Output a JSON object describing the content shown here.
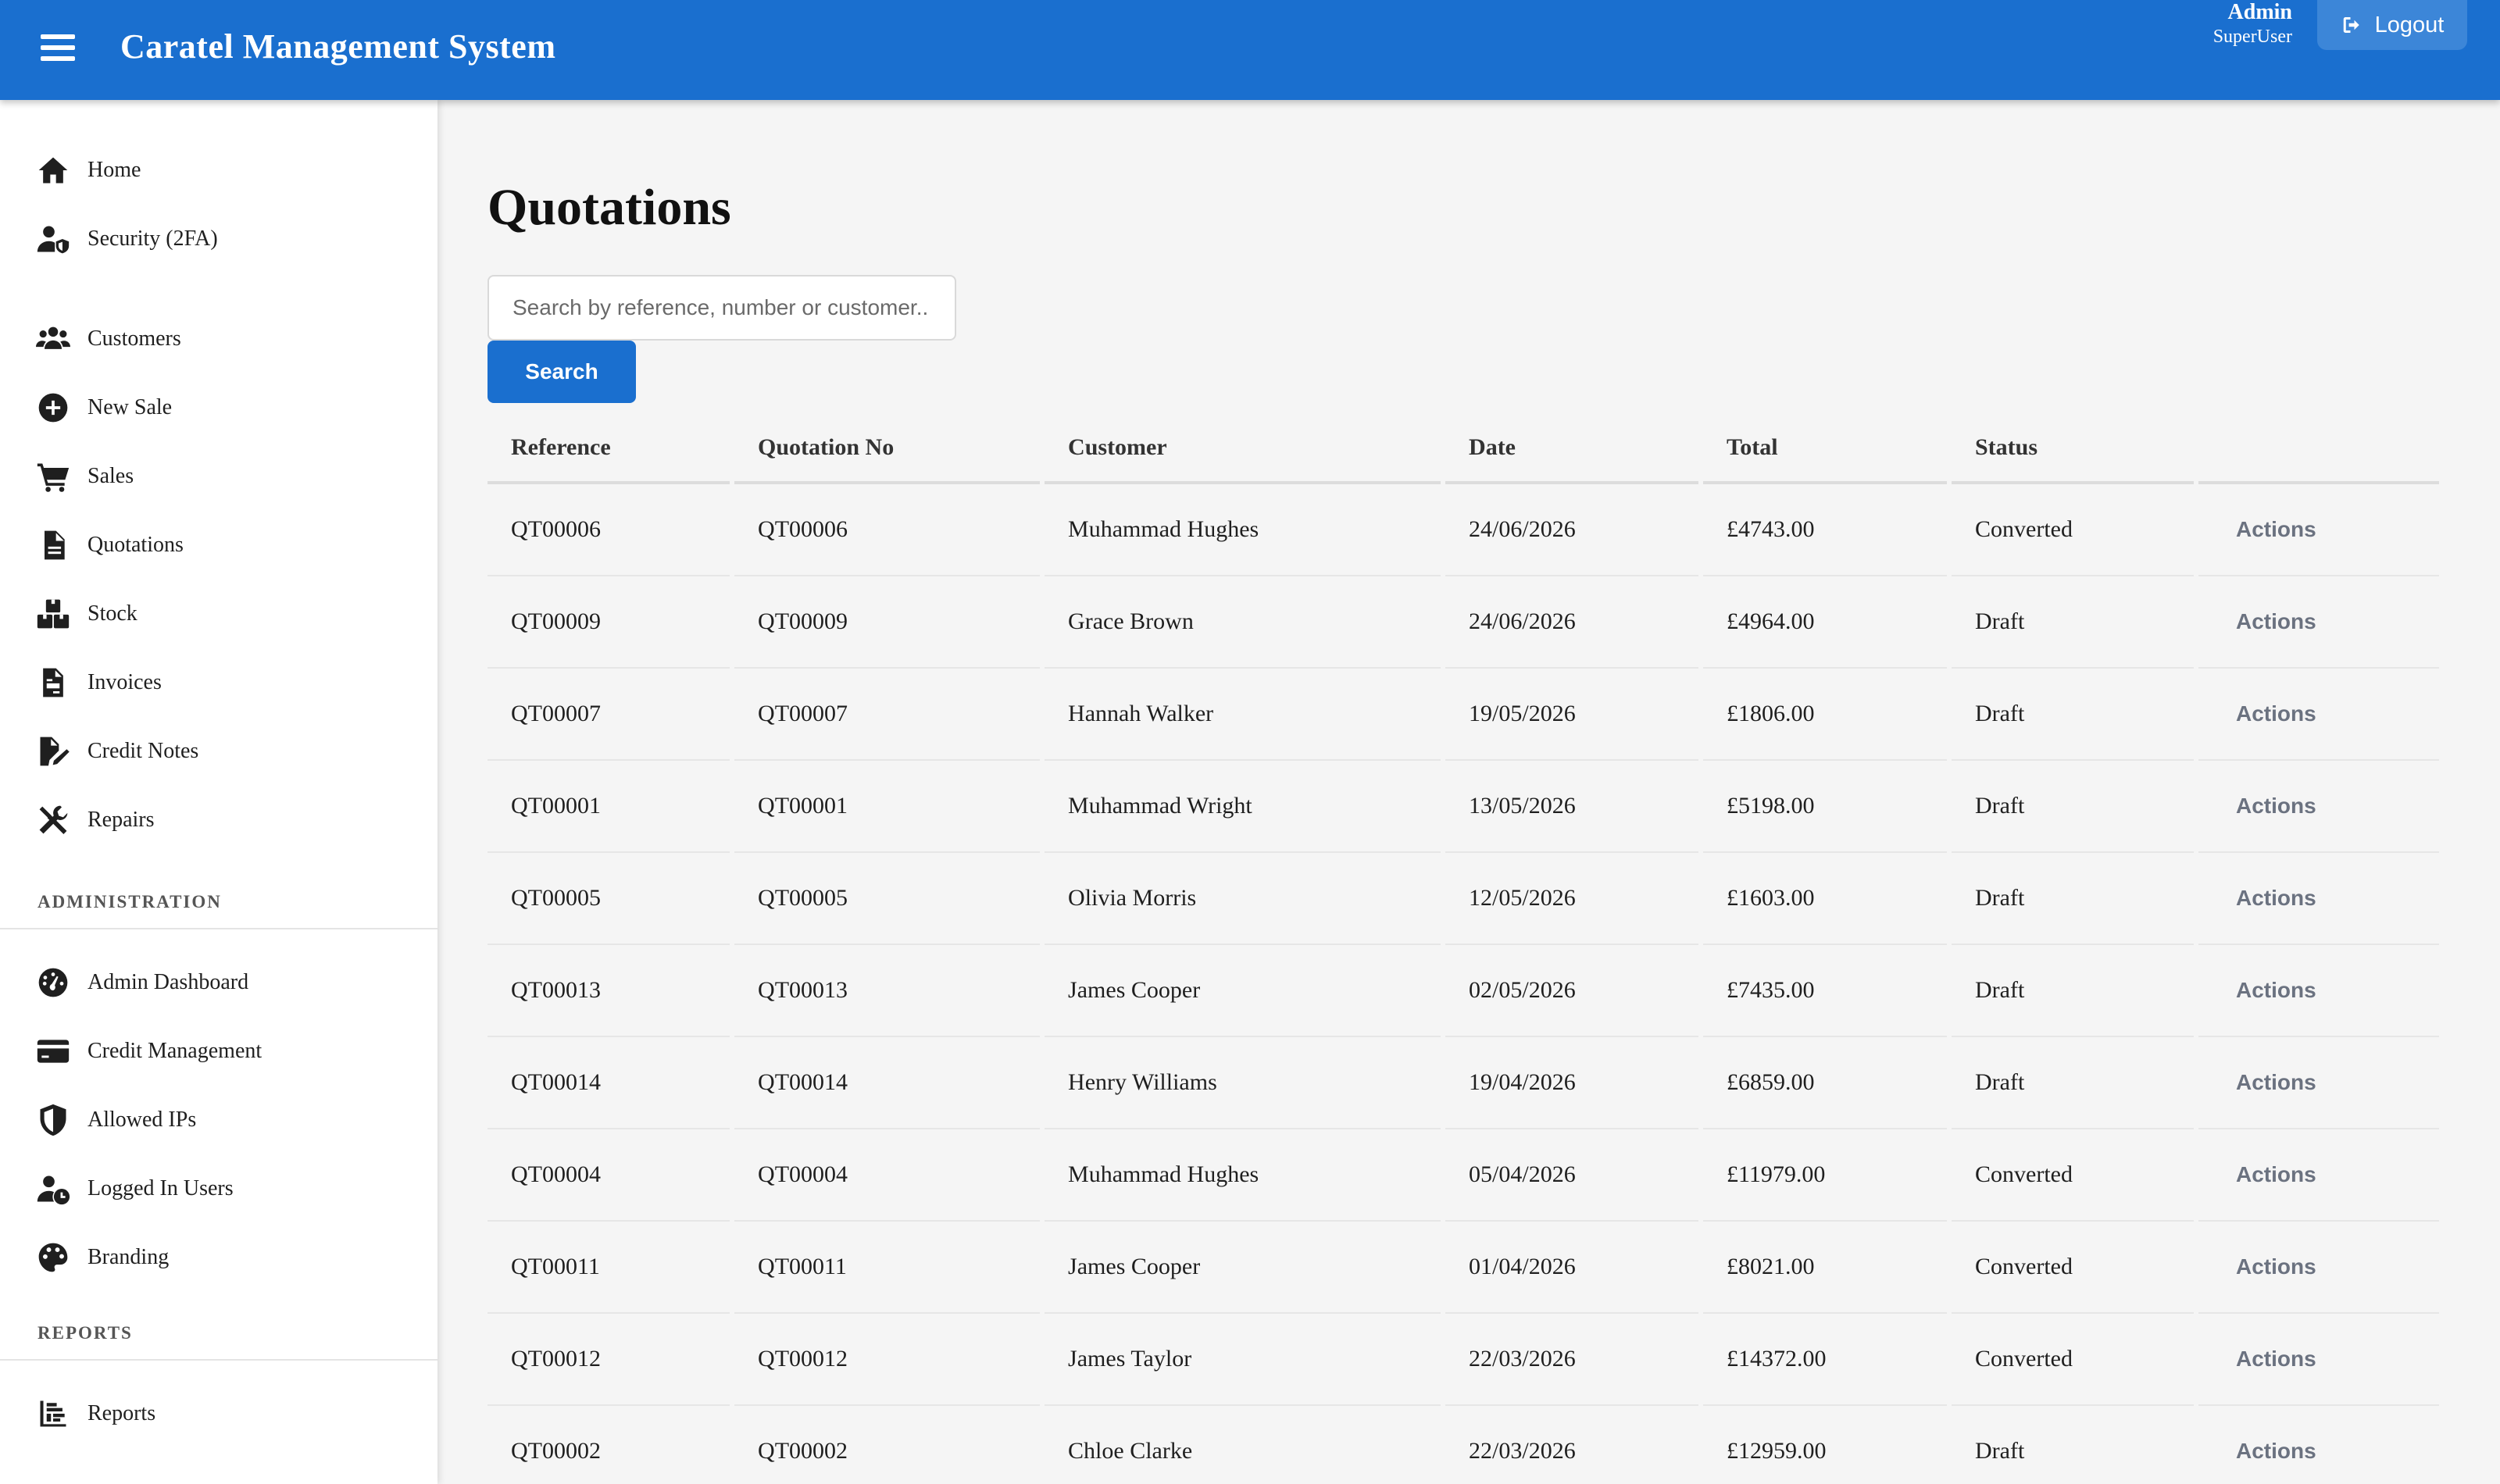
{
  "header": {
    "app_title": "Caratel Management System",
    "user_name": "Admin",
    "user_role": "SuperUser",
    "logout_label": "Logout",
    "brand_color": "#1a6fcf"
  },
  "sidebar": {
    "main_items": [
      {
        "label": "Home",
        "icon": "home-icon"
      },
      {
        "label": "Security (2FA)",
        "icon": "user-shield-icon"
      }
    ],
    "operations_items": [
      {
        "label": "Customers",
        "icon": "users-icon"
      },
      {
        "label": "New Sale",
        "icon": "plus-circle-icon"
      },
      {
        "label": "Sales",
        "icon": "cart-icon"
      },
      {
        "label": "Quotations",
        "icon": "file-icon"
      },
      {
        "label": "Stock",
        "icon": "boxes-icon"
      },
      {
        "label": "Invoices",
        "icon": "invoice-icon"
      },
      {
        "label": "Credit Notes",
        "icon": "file-edit-icon"
      },
      {
        "label": "Repairs",
        "icon": "tools-icon"
      }
    ],
    "admin_section_title": "ADMINISTRATION",
    "admin_items": [
      {
        "label": "Admin Dashboard",
        "icon": "dashboard-gauge-icon"
      },
      {
        "label": "Credit Management",
        "icon": "credit-card-icon"
      },
      {
        "label": "Allowed IPs",
        "icon": "shield-icon"
      },
      {
        "label": "Logged In Users",
        "icon": "user-clock-icon"
      },
      {
        "label": "Branding",
        "icon": "palette-icon"
      }
    ],
    "reports_section_title": "REPORTS",
    "reports_items": [
      {
        "label": "Reports",
        "icon": "bar-chart-icon"
      }
    ]
  },
  "main": {
    "page_title": "Quotations",
    "search": {
      "placeholder": "Search by reference, number or customer..",
      "button_label": "Search"
    },
    "table": {
      "columns": [
        "Reference",
        "Quotation No",
        "Customer",
        "Date",
        "Total",
        "Status",
        ""
      ],
      "action_label": "Actions",
      "rows": [
        {
          "reference": "QT00006",
          "quotation_no": "QT00006",
          "customer": "Muhammad Hughes",
          "date": "24/06/2026",
          "total": "£4743.00",
          "status": "Converted"
        },
        {
          "reference": "QT00009",
          "quotation_no": "QT00009",
          "customer": "Grace Brown",
          "date": "24/06/2026",
          "total": "£4964.00",
          "status": "Draft"
        },
        {
          "reference": "QT00007",
          "quotation_no": "QT00007",
          "customer": "Hannah Walker",
          "date": "19/05/2026",
          "total": "£1806.00",
          "status": "Draft"
        },
        {
          "reference": "QT00001",
          "quotation_no": "QT00001",
          "customer": "Muhammad Wright",
          "date": "13/05/2026",
          "total": "£5198.00",
          "status": "Draft"
        },
        {
          "reference": "QT00005",
          "quotation_no": "QT00005",
          "customer": "Olivia Morris",
          "date": "12/05/2026",
          "total": "£1603.00",
          "status": "Draft"
        },
        {
          "reference": "QT00013",
          "quotation_no": "QT00013",
          "customer": "James Cooper",
          "date": "02/05/2026",
          "total": "£7435.00",
          "status": "Draft"
        },
        {
          "reference": "QT00014",
          "quotation_no": "QT00014",
          "customer": "Henry Williams",
          "date": "19/04/2026",
          "total": "£6859.00",
          "status": "Draft"
        },
        {
          "reference": "QT00004",
          "quotation_no": "QT00004",
          "customer": "Muhammad Hughes",
          "date": "05/04/2026",
          "total": "£11979.00",
          "status": "Converted"
        },
        {
          "reference": "QT00011",
          "quotation_no": "QT00011",
          "customer": "James Cooper",
          "date": "01/04/2026",
          "total": "£8021.00",
          "status": "Converted"
        },
        {
          "reference": "QT00012",
          "quotation_no": "QT00012",
          "customer": "James Taylor",
          "date": "22/03/2026",
          "total": "£14372.00",
          "status": "Converted"
        },
        {
          "reference": "QT00002",
          "quotation_no": "QT00002",
          "customer": "Chloe Clarke",
          "date": "22/03/2026",
          "total": "£12959.00",
          "status": "Draft"
        }
      ]
    }
  }
}
